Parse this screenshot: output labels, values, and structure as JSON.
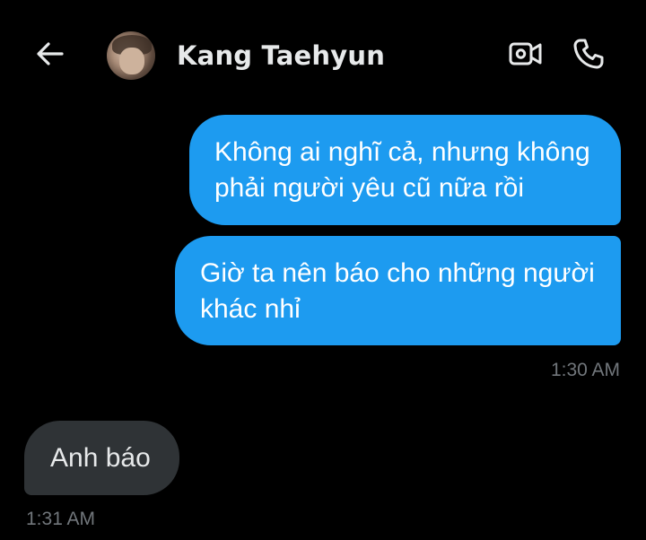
{
  "header": {
    "back_icon": "arrow-left-icon",
    "contact_name": "Kang Taehyun",
    "video_icon": "video-camera-icon",
    "call_icon": "phone-icon"
  },
  "messages": [
    {
      "direction": "outgoing",
      "text": "Không ai nghĩ cả, nhưng không phải người yêu cũ nữa rồi"
    },
    {
      "direction": "outgoing",
      "text": "Giờ ta nên báo cho những người khác nhỉ"
    },
    {
      "direction": "incoming",
      "text": "Anh báo"
    }
  ],
  "timestamps": {
    "outgoing_group": "1:30 AM",
    "incoming_group": "1:31 AM"
  },
  "colors": {
    "background": "#000000",
    "outgoing_bubble": "#1d9bf0",
    "incoming_bubble": "#2f3336",
    "timestamp": "#71767b",
    "text": "#e7e9ea"
  }
}
